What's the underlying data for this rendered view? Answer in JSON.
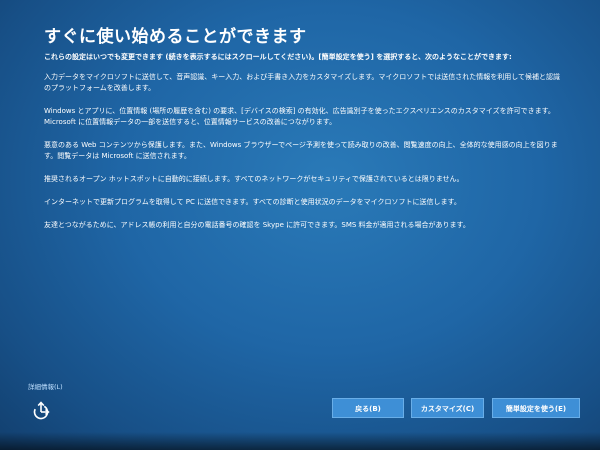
{
  "title": "すぐに使い始めることができます",
  "intro": "これらの設定はいつでも変更できます (続きを表示するにはスクロールしてください)。[簡単設定を使う] を選択すると、次のようなことができます:",
  "paragraphs": [
    "入力データをマイクロソフトに送信して、音声認識、キー入力、および手書き入力をカスタマイズします。マイクロソフトでは送信された情報を利用して候補と認識のプラットフォームを改善します。",
    "Windows とアプリに、位置情報 (場所の履歴を含む) の要求、[デバイスの検索] の有効化、広告識別子を使ったエクスペリエンスのカスタマイズを許可できます。Microsoft に位置情報データの一部を送信すると、位置情報サービスの改善につながります。",
    "悪意のある Web コンテンツから保護します。また、Windows ブラウザーでページ予測を使って読み取りの改善、閲覧速度の向上、全体的な使用感の向上を図ります。閲覧データは Microsoft に送信されます。",
    "推奨されるオープン ホットスポットに自動的に接続します。すべてのネットワークがセキュリティで保護されているとは限りません。",
    "インターネットで更新プログラムを取得して PC に送信できます。すべての診断と使用状況のデータをマイクロソフトに送信します。",
    "友達とつながるために、アドレス帳の利用と自分の電話番号の確認を Skype に許可できます。SMS 料金が適用される場合があります。"
  ],
  "details_link": "詳細情報(L)",
  "buttons": {
    "back": "戻る(B)",
    "customize": "カスタマイズ(C)",
    "express": "簡単設定を使う(E)"
  },
  "icons": {
    "accessibility": "ease-of-access-icon"
  }
}
